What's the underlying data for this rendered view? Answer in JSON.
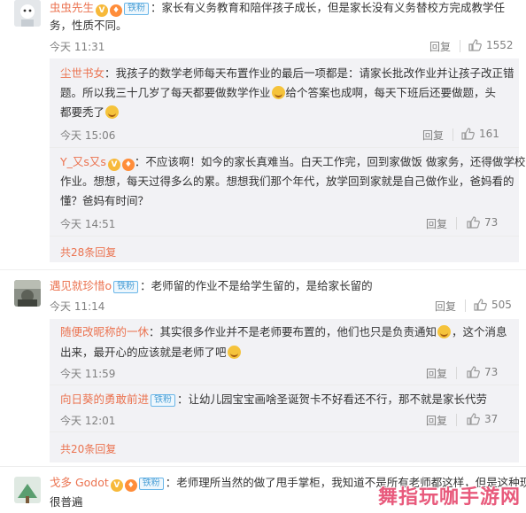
{
  "reply_label": "回复",
  "colors": {
    "name": "#eb7350",
    "badge": "#4a9fd6",
    "time": "#808080",
    "subbox": "#f2f2f5"
  },
  "c1": {
    "user": "虫虫先生",
    "badge": "铁粉",
    "line1": "：家长有义务教育和陪伴孩子成长，但是家长没有义务替校方完成教学任",
    "line2": "务，性质不同。",
    "time": "今天 11:31",
    "likes": "1552",
    "replies": [
      {
        "user": "尘世书女",
        "line1": "：我孩子的数学老师每天布置作业的最后一项都是：请家长批改作业并让孩子改正错",
        "line2a": "题。所以我三十几岁了每天都要做数学作业",
        "line2b": "给个答案也成啊，每天下班后还要做题，头",
        "line3": "都要秃了",
        "time": "今天 15:06",
        "likes": "161"
      },
      {
        "user": "Y_又s又s",
        "line1": "：不应该啊！如今的家长真难当。白天工作完，回到家做饭 做家务，还得做学校的",
        "line2": "作业。想想，每天过得多么的累。想想我们那个年代，放学回到家就是自己做作业，爸妈看的",
        "line3": "懂？爸妈有时间？",
        "time": "今天 14:51",
        "likes": "73"
      }
    ],
    "more": "共28条回复"
  },
  "c2": {
    "user": "遇见就珍惜o",
    "badge": "铁粉",
    "line1": "：老师留的作业不是给学生留的，是给家长留的",
    "time": "今天 11:14",
    "likes": "505",
    "replies": [
      {
        "user": "随便改昵称的一休",
        "line1a": "：其实很多作业并不是老师要布置的，他们也只是负责通知",
        "line1b": "，这个消息",
        "line2": "出来，最开心的应该就是老师了吧",
        "time": "今天 11:59",
        "likes": "73"
      },
      {
        "user": "向日葵的勇敢前进",
        "badge": "铁粉",
        "line1": "：让幼儿园宝宝画啥圣诞贺卡不好看还不行，那不就是家长代劳",
        "time": "今天 12:01",
        "likes": "37"
      }
    ],
    "more": "共20条回复"
  },
  "c3": {
    "user": "戈多 Godot",
    "badge": "铁粉",
    "line1": "：老师理所当然的做了甩手掌柜，我知道不是所有老师都这样，但是这种现象",
    "line2": "很普遍"
  },
  "watermark": "舞指玩咖手游网"
}
